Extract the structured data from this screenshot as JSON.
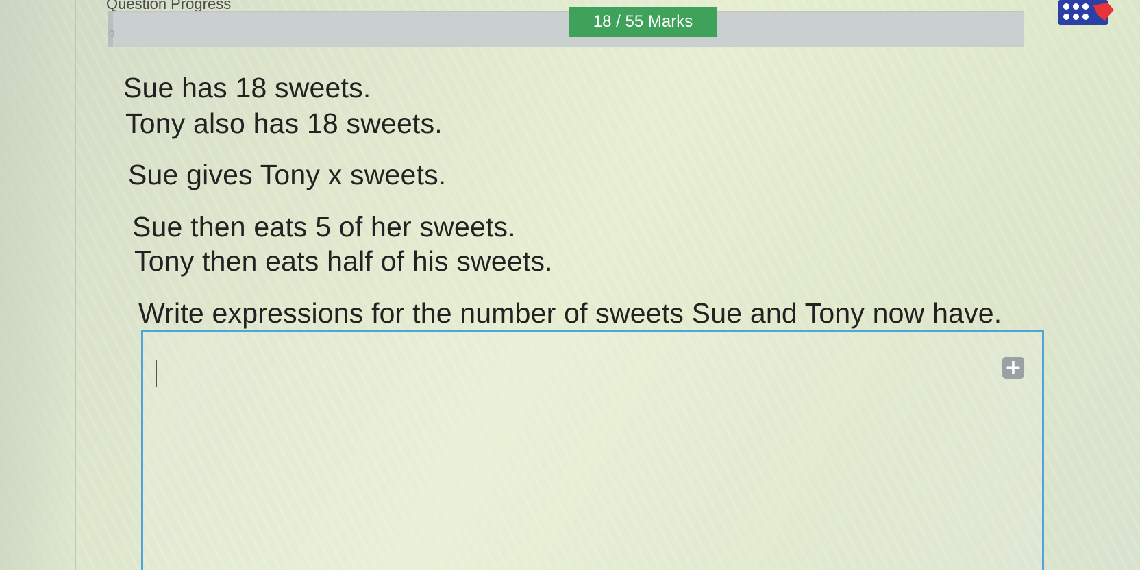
{
  "header": {
    "progress_label": "Question Progress",
    "progress_start": "0",
    "marks": "18 / 55 Marks",
    "marks_color": "#3fa25a",
    "logo_icon": "app-logo-icon"
  },
  "question": {
    "lines": [
      "Sue has 18 sweets.",
      "Tony also has 18 sweets.",
      "Sue gives Tony x sweets.",
      "Sue then eats 5 of her sweets.",
      "Tony then eats half of his sweets.",
      "Write expressions for the number of sweets Sue and Tony now have."
    ]
  },
  "answer": {
    "value": "",
    "border_color": "#4ea4db",
    "add_button_icon": "plus-icon",
    "add_button_glyph": "+"
  }
}
